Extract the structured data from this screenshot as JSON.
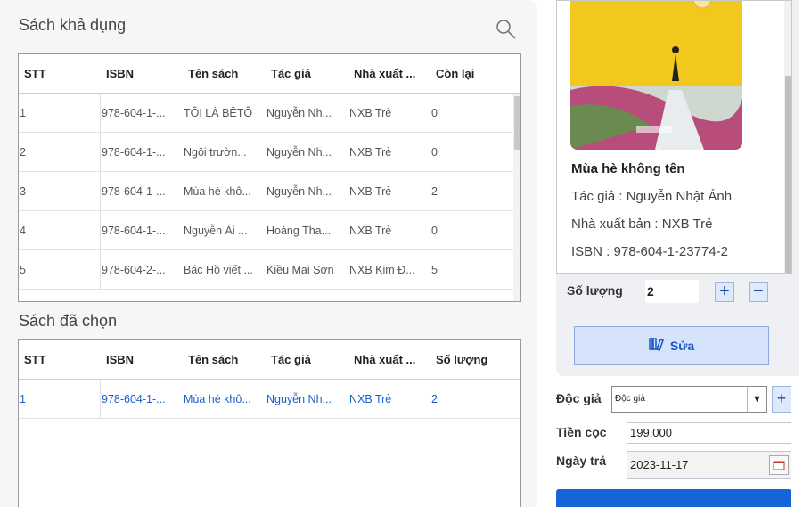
{
  "available": {
    "title": "Sách khả dụng",
    "columns": [
      "STT",
      "ISBN",
      "Tên sách",
      "Tác giả",
      "Nhà xuất ...",
      "Còn lại"
    ],
    "rows": [
      [
        "1",
        "978-604-1-...",
        "TÔI LÀ BÊTÔ",
        "Nguyễn Nh...",
        "NXB Trẻ",
        "0"
      ],
      [
        "2",
        "978-604-1-...",
        "Ngôi trườn...",
        "Nguyễn Nh...",
        "NXB Trẻ",
        "0"
      ],
      [
        "3",
        "978-604-1-...",
        "Mùa hè khô...",
        "Nguyễn Nh...",
        "NXB Trẻ",
        "2"
      ],
      [
        "4",
        "978-604-1-...",
        "Nguyễn Ái ...",
        "Hoàng Tha...",
        "NXB Trẻ",
        "0"
      ],
      [
        "5",
        "978-604-2-...",
        "Bác Hồ viết ...",
        "Kiều Mai Sơn",
        "NXB Kim Đ...",
        "5"
      ]
    ]
  },
  "selected": {
    "title": "Sách đã chọn",
    "columns": [
      "STT",
      "ISBN",
      "Tên sách",
      "Tác giả",
      "Nhà xuất ...",
      "Số lượng"
    ],
    "rows": [
      [
        "1",
        "978-604-1-...",
        "Mùa hè khô...",
        "Nguyễn Nh...",
        "NXB Trẻ",
        "2"
      ]
    ]
  },
  "book": {
    "title": "Mùa hè không tên",
    "author": "Tác giả :  Nguyễn Nhật Ánh",
    "publisher": "Nhà xuất bản :  NXB Trẻ",
    "isbn": "ISBN :  978-604-1-23774-2"
  },
  "quantity": {
    "label": "Số lượng",
    "value": "2",
    "plus": "+",
    "minus": "−"
  },
  "edit_button": {
    "label": "Sửa"
  },
  "form": {
    "reader_label": "Độc giả",
    "reader_value": "Độc giả",
    "deposit_label": "Tiền cọc",
    "deposit_value": "199,000",
    "return_label": "Ngày trả",
    "return_value": "2023-11-17"
  },
  "colors": {
    "accent": "#1565d8",
    "selected_text": "#1a5fd0",
    "panel": "#f5f6f8"
  },
  "icons": {
    "search": "search-icon",
    "edit": "book-edit-icon",
    "calendar": "calendar-icon"
  }
}
